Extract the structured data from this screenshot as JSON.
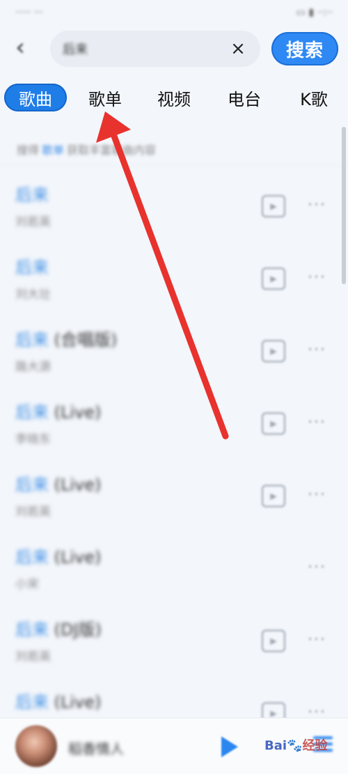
{
  "header": {
    "back_icon": "chevron-left-icon",
    "search_value": "后来",
    "clear_icon": "close-icon",
    "search_button_label": "搜索"
  },
  "tabs": [
    {
      "label": "歌曲",
      "active": true
    },
    {
      "label": "歌单",
      "active": false
    },
    {
      "label": "视频",
      "active": false
    },
    {
      "label": "电台",
      "active": false
    },
    {
      "label": "K歌",
      "active": false
    }
  ],
  "hint": {
    "prefix": "搜得",
    "keyword": "歌单",
    "suffix": "获取丰富歌曲内容"
  },
  "songs": [
    {
      "keyword": "后来",
      "suffix": "",
      "artist": "刘若英",
      "has_mv": true
    },
    {
      "keyword": "后来",
      "suffix": "",
      "artist": "刘大壮",
      "has_mv": true
    },
    {
      "keyword": "后来",
      "suffix": " (合唱版)",
      "artist": "路大源",
      "has_mv": true
    },
    {
      "keyword": "后来",
      "suffix": " (Live)",
      "artist": "李晓东",
      "has_mv": true
    },
    {
      "keyword": "后来",
      "suffix": " (Live)",
      "artist": "刘若英",
      "has_mv": true
    },
    {
      "keyword": "后来",
      "suffix": " (Live)",
      "artist": "小宋",
      "has_mv": false
    },
    {
      "keyword": "后来",
      "suffix": " (DJ版)",
      "artist": "刘若英",
      "has_mv": true
    },
    {
      "keyword": "后来",
      "suffix": " (Live)",
      "artist": "",
      "has_mv": true
    }
  ],
  "player": {
    "now_playing": "稻香情人",
    "play_icon": "play-icon",
    "playlist_icon": "playlist-icon"
  },
  "watermark": {
    "brand": "Bai",
    "text": "经验"
  },
  "colors": {
    "accent": "#2f89f4",
    "keyword": "#3d8fe6",
    "annotation_arrow": "#e8322e"
  }
}
